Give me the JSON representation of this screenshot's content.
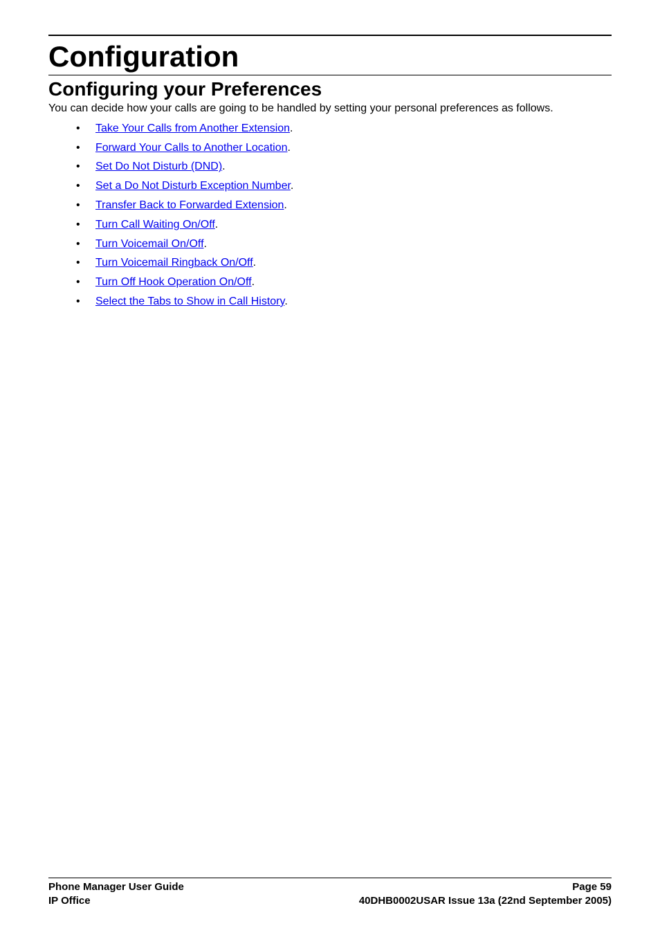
{
  "heading1": "Configuration",
  "heading2": "Configuring your Preferences",
  "intro": "You can decide how your calls are going to be handled by setting your personal preferences as follows.",
  "links": [
    "Take Your Calls from Another Extension",
    "Forward Your Calls to Another Location",
    "Set Do Not Disturb (DND)",
    "Set a Do Not Disturb Exception Number",
    "Transfer Back to Forwarded Extension",
    "Turn Call Waiting On/Off",
    "Turn Voicemail On/Off",
    "Turn Voicemail Ringback On/Off",
    "Turn Off Hook Operation On/Off",
    "Select the Tabs to Show in Call History"
  ],
  "footer": {
    "left1": "Phone Manager User Guide",
    "right1": "Page 59",
    "left2": "IP Office",
    "right2": "40DHB0002USAR Issue 13a (22nd September 2005)"
  }
}
